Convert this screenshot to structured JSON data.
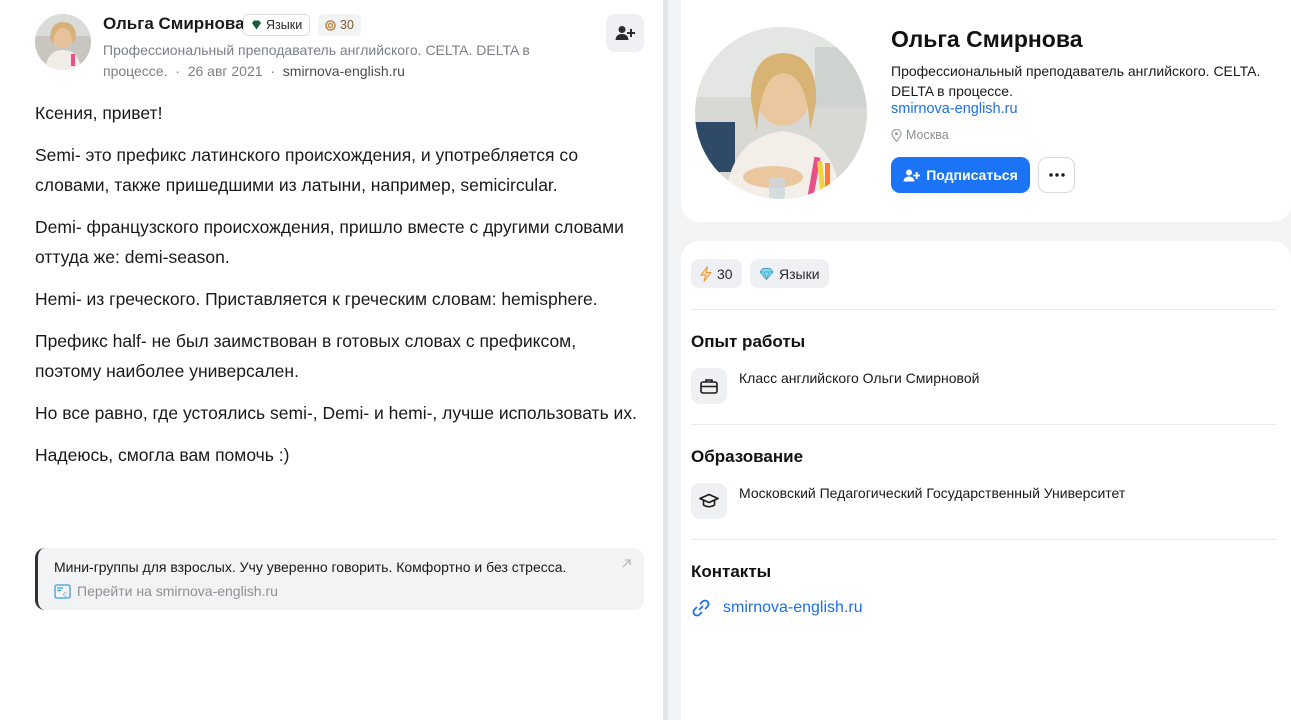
{
  "post": {
    "author_name": "Ольга Смирнова",
    "badge_lang": "Языки",
    "badge_score": "30",
    "bio": "Профессиональный преподаватель английского. CELTA. DELTA в процессе.",
    "date": "26 авг 2021",
    "site": "smirnova-english.ru",
    "paragraphs": [
      "Ксения, привет!",
      "Semi- это префикс латинского происхождения, и употребляется со словами, также пришедшими из латыни, например, semicircular.",
      "Demi- французского происхождения, пришло вместе с другими словами оттуда же: demi-season.",
      "Hemi- из греческого. Приставляется к греческим словам: hemisphere.",
      "Префикс half- не был заимствован в готовых словах с префиксом, поэтому наиболее универсален.",
      "Но все равно, где устоялись semi-, Demi- и hemi-, лучше использовать их.",
      "Надеюсь, смогла вам помочь :)"
    ],
    "link_card": {
      "text": "Мини-группы для взрослых. Учу уверенно говорить. Комфортно и без стресса.",
      "sub": "Перейти на smirnova-english.ru"
    }
  },
  "profile": {
    "name": "Ольга Смирнова",
    "bio": "Профессиональный преподаватель английского. CELTA. DELTA в процессе.",
    "site": "smirnova-english.ru",
    "city": "Москва",
    "subscribe_label": "Подписаться",
    "chips": {
      "score": "30",
      "topic": "Языки"
    },
    "work_title": "Опыт работы",
    "work_item": "Класс английского Ольги Смирновой",
    "edu_title": "Образование",
    "edu_item": "Московский Педагогический Государственный Университет",
    "contacts_title": "Контакты",
    "contact_link": "smirnova-english.ru"
  },
  "colors": {
    "accent": "#1b74f5",
    "link": "#1f6fe5",
    "panel_bg": "#f2f3f5"
  }
}
